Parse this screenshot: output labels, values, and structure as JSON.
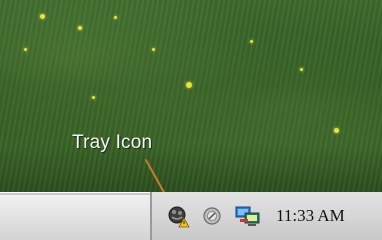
{
  "callout": {
    "label": "Tray Icon"
  },
  "system_tray": {
    "icons": [
      {
        "name": "agent-icon",
        "description": "tray application icon with yellow badge"
      },
      {
        "name": "volume-icon"
      },
      {
        "name": "network-icon"
      }
    ],
    "clock": "11:33 AM"
  },
  "colors": {
    "taskbar": "#d6d6d6",
    "tray_border": "#9a9a9a",
    "callout_line": "#c97a2a",
    "callout_text": "#f4f4f4"
  }
}
